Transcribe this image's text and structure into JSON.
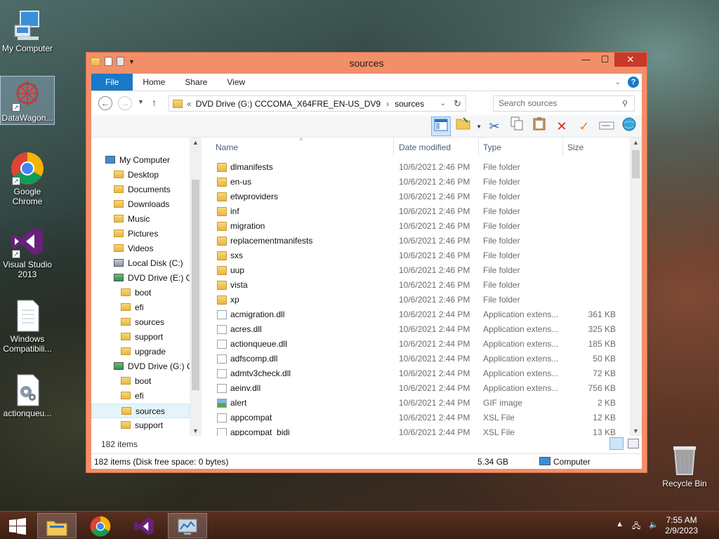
{
  "desktop": {
    "icons": [
      {
        "label": "My Computer"
      },
      {
        "label": "DataWagon..."
      },
      {
        "label": "Google Chrome"
      },
      {
        "label": "Visual Studio 2013"
      },
      {
        "label": "Windows Compatibili..."
      },
      {
        "label": "actionqueu..."
      },
      {
        "label": "Recycle Bin"
      }
    ]
  },
  "window": {
    "title": "sources",
    "tabs": {
      "file": "File",
      "home": "Home",
      "share": "Share",
      "view": "View"
    },
    "help": "?",
    "address": {
      "prefix": "«",
      "drive": "DVD Drive (G:) CCCOMA_X64FRE_EN-US_DV9",
      "sep": "›",
      "folder": "sources"
    },
    "search_placeholder": "Search sources",
    "nav": [
      {
        "label": "My Computer",
        "indent": 20,
        "kind": "pc"
      },
      {
        "label": "Desktop",
        "indent": 32,
        "kind": "folder"
      },
      {
        "label": "Documents",
        "indent": 32,
        "kind": "folder"
      },
      {
        "label": "Downloads",
        "indent": 32,
        "kind": "folder"
      },
      {
        "label": "Music",
        "indent": 32,
        "kind": "folder"
      },
      {
        "label": "Pictures",
        "indent": 32,
        "kind": "folder"
      },
      {
        "label": "Videos",
        "indent": 32,
        "kind": "folder"
      },
      {
        "label": "Local Disk (C:)",
        "indent": 32,
        "kind": "disk"
      },
      {
        "label": "DVD Drive (E:) GS",
        "indent": 32,
        "kind": "dvd"
      },
      {
        "label": "boot",
        "indent": 42,
        "kind": "folder"
      },
      {
        "label": "efi",
        "indent": 42,
        "kind": "folder"
      },
      {
        "label": "sources",
        "indent": 42,
        "kind": "folder"
      },
      {
        "label": "support",
        "indent": 42,
        "kind": "folder"
      },
      {
        "label": "upgrade",
        "indent": 42,
        "kind": "folder"
      },
      {
        "label": "DVD Drive (G:) CC",
        "indent": 32,
        "kind": "dvd"
      },
      {
        "label": "boot",
        "indent": 42,
        "kind": "folder"
      },
      {
        "label": "efi",
        "indent": 42,
        "kind": "folder"
      },
      {
        "label": "sources",
        "indent": 42,
        "kind": "folder",
        "selected": true
      },
      {
        "label": "support",
        "indent": 42,
        "kind": "folder"
      }
    ],
    "columns": {
      "name": "Name",
      "date": "Date modified",
      "type": "Type",
      "size": "Size"
    },
    "files": [
      {
        "name": "dlmanifests",
        "date": "10/6/2021 2:46 PM",
        "type": "File folder",
        "size": "",
        "kind": "folder"
      },
      {
        "name": "en-us",
        "date": "10/6/2021 2:46 PM",
        "type": "File folder",
        "size": "",
        "kind": "folder"
      },
      {
        "name": "etwproviders",
        "date": "10/6/2021 2:46 PM",
        "type": "File folder",
        "size": "",
        "kind": "folder"
      },
      {
        "name": "inf",
        "date": "10/6/2021 2:46 PM",
        "type": "File folder",
        "size": "",
        "kind": "folder"
      },
      {
        "name": "migration",
        "date": "10/6/2021 2:46 PM",
        "type": "File folder",
        "size": "",
        "kind": "folder"
      },
      {
        "name": "replacementmanifests",
        "date": "10/6/2021 2:46 PM",
        "type": "File folder",
        "size": "",
        "kind": "folder"
      },
      {
        "name": "sxs",
        "date": "10/6/2021 2:46 PM",
        "type": "File folder",
        "size": "",
        "kind": "folder"
      },
      {
        "name": "uup",
        "date": "10/6/2021 2:46 PM",
        "type": "File folder",
        "size": "",
        "kind": "folder"
      },
      {
        "name": "vista",
        "date": "10/6/2021 2:46 PM",
        "type": "File folder",
        "size": "",
        "kind": "folder"
      },
      {
        "name": "xp",
        "date": "10/6/2021 2:46 PM",
        "type": "File folder",
        "size": "",
        "kind": "folder"
      },
      {
        "name": "acmigration.dll",
        "date": "10/6/2021 2:44 PM",
        "type": "Application extens...",
        "size": "361 KB",
        "kind": "file"
      },
      {
        "name": "acres.dll",
        "date": "10/6/2021 2:44 PM",
        "type": "Application extens...",
        "size": "325 KB",
        "kind": "file"
      },
      {
        "name": "actionqueue.dll",
        "date": "10/6/2021 2:44 PM",
        "type": "Application extens...",
        "size": "185 KB",
        "kind": "file"
      },
      {
        "name": "adfscomp.dll",
        "date": "10/6/2021 2:44 PM",
        "type": "Application extens...",
        "size": "50 KB",
        "kind": "file"
      },
      {
        "name": "admtv3check.dll",
        "date": "10/6/2021 2:44 PM",
        "type": "Application extens...",
        "size": "72 KB",
        "kind": "file"
      },
      {
        "name": "aeinv.dll",
        "date": "10/6/2021 2:44 PM",
        "type": "Application extens...",
        "size": "756 KB",
        "kind": "file"
      },
      {
        "name": "alert",
        "date": "10/6/2021 2:44 PM",
        "type": "GIF image",
        "size": "2 KB",
        "kind": "image"
      },
      {
        "name": "appcompat",
        "date": "10/6/2021 2:44 PM",
        "type": "XSL File",
        "size": "12 KB",
        "kind": "file"
      },
      {
        "name": "appcompat_bidi",
        "date": "10/6/2021 2:44 PM",
        "type": "XSL File",
        "size": "13 KB",
        "kind": "file"
      }
    ],
    "item_count": "182 items",
    "status": {
      "left": "182 items (Disk free space: 0 bytes)",
      "size": "5.34 GB",
      "location": "Computer"
    }
  },
  "taskbar": {
    "time": "7:55 AM",
    "date": "2/9/2023"
  },
  "colors": {
    "accent": "#1979ca",
    "title_bar": "#f28f69",
    "close": "#c7392b"
  }
}
